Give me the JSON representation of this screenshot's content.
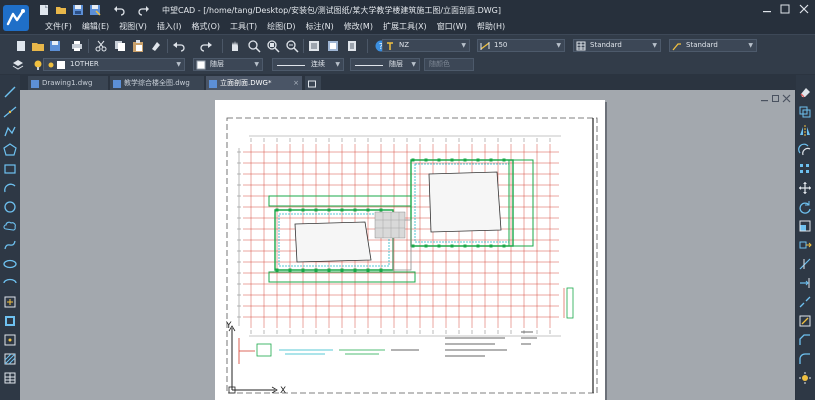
{
  "window": {
    "app_name": "中望CAD",
    "title": "中望CAD - [/home/tang/Desktop/安装包/测试图纸/某大学教学楼建筑施工图/立面剖面.DWG]"
  },
  "menu": [
    {
      "label": "文件(F)"
    },
    {
      "label": "编辑(E)"
    },
    {
      "label": "视图(V)"
    },
    {
      "label": "插入(I)"
    },
    {
      "label": "格式(O)"
    },
    {
      "label": "工具(T)"
    },
    {
      "label": "绘图(D)"
    },
    {
      "label": "标注(N)"
    },
    {
      "label": "修改(M)"
    },
    {
      "label": "扩展工具(X)"
    },
    {
      "label": "窗口(W)"
    },
    {
      "label": "帮助(H)"
    }
  ],
  "toolbar": {
    "text_style": "NZ",
    "dim_style": "150",
    "table_style": "Standard",
    "multileader_style": "Standard",
    "layer": "1OTHER",
    "color": "随层",
    "linetype": "连续",
    "lineweight": "随层",
    "plotstyle": "随颜色"
  },
  "tabs": [
    {
      "label": "Drawing1.dwg",
      "active": false
    },
    {
      "label": "教学综合楼全图.dwg",
      "active": false
    },
    {
      "label": "立面剖面.DWG*",
      "active": true
    }
  ],
  "ucs": {
    "x_label": "X",
    "y_label": "Y"
  },
  "colors": {
    "titlebar": "#27303c",
    "toolbar": "#323c49",
    "canvas": "#a3a8ae",
    "drawing_red": "#d23a2a",
    "drawing_green": "#1aa84a",
    "drawing_cyan": "#22b6c8",
    "drawing_gray": "#8a8a8a"
  }
}
